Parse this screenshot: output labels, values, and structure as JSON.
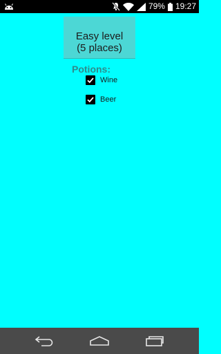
{
  "status_bar": {
    "battery_percent": "79%",
    "time": "19:27",
    "icons": [
      "android-icon",
      "mute-icon",
      "wifi-icon",
      "signal-icon",
      "battery-icon"
    ]
  },
  "level_button": {
    "label": "Easy level\n(5 places)"
  },
  "potions": {
    "label": "Potions:",
    "items": [
      {
        "label": "Wine",
        "checked": true
      },
      {
        "label": "Beer",
        "checked": true
      }
    ]
  },
  "nav_bar": {
    "icons": [
      "back-icon",
      "home-icon",
      "recents-icon"
    ]
  },
  "colors": {
    "background": "#00FFFF",
    "button": "#4CD7D5",
    "potions_label": "#2E8C8C",
    "status_bar": "#000000",
    "nav_bar": "#4A4A4A"
  }
}
